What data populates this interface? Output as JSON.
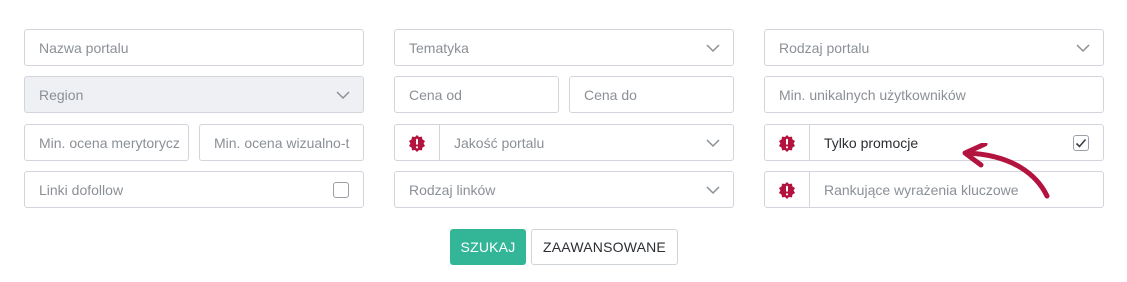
{
  "filters": {
    "portal_name_placeholder": "Nazwa portalu",
    "topic_placeholder": "Tematyka",
    "portal_type_placeholder": "Rodzaj portalu",
    "region_placeholder": "Region",
    "price_from_placeholder": "Cena od",
    "price_to_placeholder": "Cena do",
    "min_unique_users_placeholder": "Min. unikalnych użytkowników",
    "min_content_rating_placeholder": "Min. ocena merytorycz",
    "min_visual_rating_placeholder": "Min. ocena wizualno-t",
    "portal_quality_placeholder": "Jakość portalu",
    "promotions_only_label": "Tylko promocje",
    "promotions_only_checked": true,
    "dofollow_links_label": "Linki dofollow",
    "dofollow_links_checked": false,
    "link_type_placeholder": "Rodzaj linków",
    "ranking_keywords_placeholder": "Rankujące wyrażenia kluczowe"
  },
  "actions": {
    "search_label": "SZUKAJ",
    "advanced_label": "ZAAWANSOWANE"
  },
  "colors": {
    "primary": "#33b697",
    "badge": "#b3133f",
    "arrow": "#b3133f"
  },
  "icons": {
    "dropdown": "chevron-down-icon",
    "premium": "badge-exclamation-icon",
    "check": "checkmark-icon"
  }
}
